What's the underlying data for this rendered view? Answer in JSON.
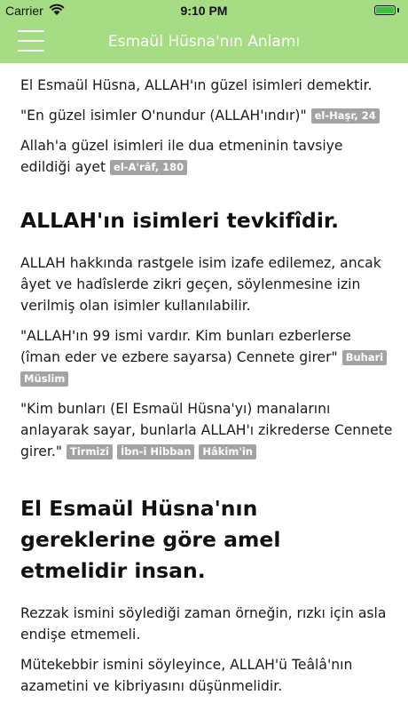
{
  "status_bar": {
    "carrier": "Carrier",
    "time": "9:10 PM",
    "battery_level": 1.0,
    "accent_color": "#a6dc83"
  },
  "nav": {
    "title": "Esmaül Hüsna'nın Anlamı",
    "menu_icon": "hamburger-menu-icon"
  },
  "content": {
    "intro": "El Esmaül Hüsna, ALLAH'ın güzel isimleri demektir.",
    "quote1": "\"En güzel isimler O'nundur (ALLAH'ındır)\"",
    "quote1_tag": "el-Haşr, 24",
    "dua": "Allah'a güzel isimleri ile dua etmeninin tavsiye edildiği ayet",
    "dua_tag": "el-A'râf, 180",
    "heading1": "ALLAH'ın isimleri tevkifîdir.",
    "para1": "ALLAH hakkında rastgele isim izafe edilemez, ancak âyet ve hadîslerde zikri geçen, söylenmesine izin verilmiş olan isimler kullanılabilir.",
    "quote2": "\"ALLAH'ın 99 ismi vardır. Kim bunları ezberlerse (îman eder ve ezbere sayarsa) Cennete girer\"",
    "quote2_tags": [
      "Buhari",
      "Müslim"
    ],
    "quote3": "\"Kim bunları (El Esmaül Hüsna'yı) manalarını anlayarak sayar, bunlarla ALLAH'ı zikrederse Cennete girer.\"",
    "quote3_tags": [
      "Tirmizî",
      "İbn-i Hibban",
      "Hâkim'in"
    ],
    "heading2": "El Esmaül Hüsna'nın gereklerine göre amel etmelidir insan.",
    "para2": "Rezzak ismini söylediği zaman örneğin, rızkı için asla endişe etmemeli.",
    "para3": "Mütekebbir ismini söyleyince, ALLAH'ü Teâlâ'nın azametini ve kibriyasını düşünmelidir."
  }
}
